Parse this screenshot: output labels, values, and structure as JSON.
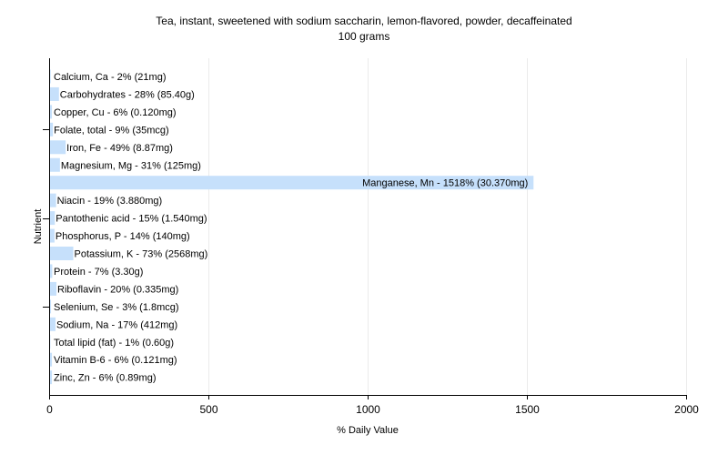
{
  "chart_data": {
    "type": "bar",
    "orientation": "horizontal",
    "title": "Tea, instant, sweetened with sodium saccharin, lemon-flavored, powder, decaffeinated",
    "subtitle": "100 grams",
    "xlabel": "% Daily Value",
    "ylabel": "Nutrient",
    "xlim": [
      0,
      2000
    ],
    "xticks": [
      0,
      500,
      1000,
      1500,
      2000
    ],
    "grid": true,
    "bar_color": "#c6e0fb",
    "categories": [
      "Calcium, Ca - 2% (21mg)",
      "Carbohydrates - 28% (85.40g)",
      "Copper, Cu - 6% (0.120mg)",
      "Folate, total - 9% (35mcg)",
      "Iron, Fe - 49% (8.87mg)",
      "Magnesium, Mg - 31% (125mg)",
      "Manganese, Mn - 1518% (30.370mg)",
      "Niacin - 19% (3.880mg)",
      "Pantothenic acid - 15% (1.540mg)",
      "Phosphorus, P - 14% (140mg)",
      "Potassium, K - 73% (2568mg)",
      "Protein - 7% (3.30g)",
      "Riboflavin - 20% (0.335mg)",
      "Selenium, Se - 3% (1.8mcg)",
      "Sodium, Na - 17% (412mg)",
      "Total lipid (fat) - 1% (0.60g)",
      "Vitamin B-6 - 6% (0.121mg)",
      "Zinc, Zn - 6% (0.89mg)"
    ],
    "values": [
      2,
      28,
      6,
      9,
      49,
      31,
      1518,
      19,
      15,
      14,
      73,
      7,
      20,
      3,
      17,
      1,
      6,
      6
    ]
  }
}
